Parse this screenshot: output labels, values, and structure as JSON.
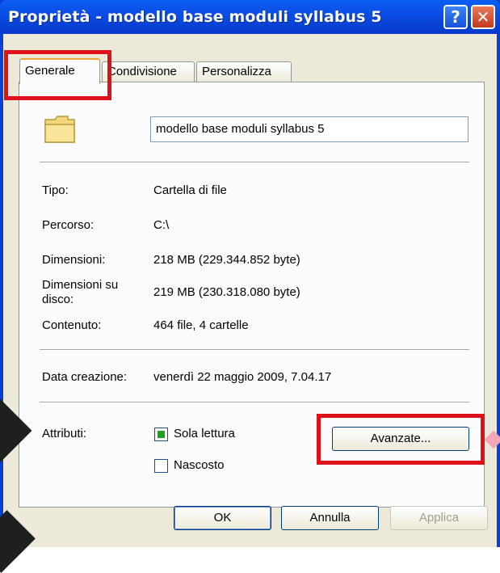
{
  "window": {
    "title": "Proprietà - modello base moduli syllabus 5",
    "help_label": "?",
    "close_label": "✕"
  },
  "tabs": [
    {
      "label": "Generale"
    },
    {
      "label": "Condivisione"
    },
    {
      "label": "Personalizza"
    }
  ],
  "general": {
    "icon": "folder-icon",
    "name_value": "modello base moduli syllabus 5",
    "rows": [
      {
        "label": "Tipo:",
        "value": "Cartella di file"
      },
      {
        "label": "Percorso:",
        "value": "C:\\"
      },
      {
        "label": "Dimensioni:",
        "value": "218 MB (229.344.852 byte)"
      },
      {
        "label": "Dimensioni su disco:",
        "value": "219 MB (230.318.080 byte)"
      },
      {
        "label": "Contenuto:",
        "value": "464 file, 4 cartelle"
      }
    ],
    "created_label": "Data creazione:",
    "created_value": "venerdì 22 maggio 2009, 7.04.17",
    "attributes_label": "Attributi:",
    "readonly_label": "Sola lettura",
    "hidden_label": "Nascosto",
    "advanced_label": "Avanzate..."
  },
  "buttons": {
    "ok": "OK",
    "cancel": "Annulla",
    "apply": "Applica"
  },
  "colors": {
    "highlight": "#e0101b",
    "title_bar": "#0b4ee6",
    "dialog_bg": "#ece9d8"
  }
}
